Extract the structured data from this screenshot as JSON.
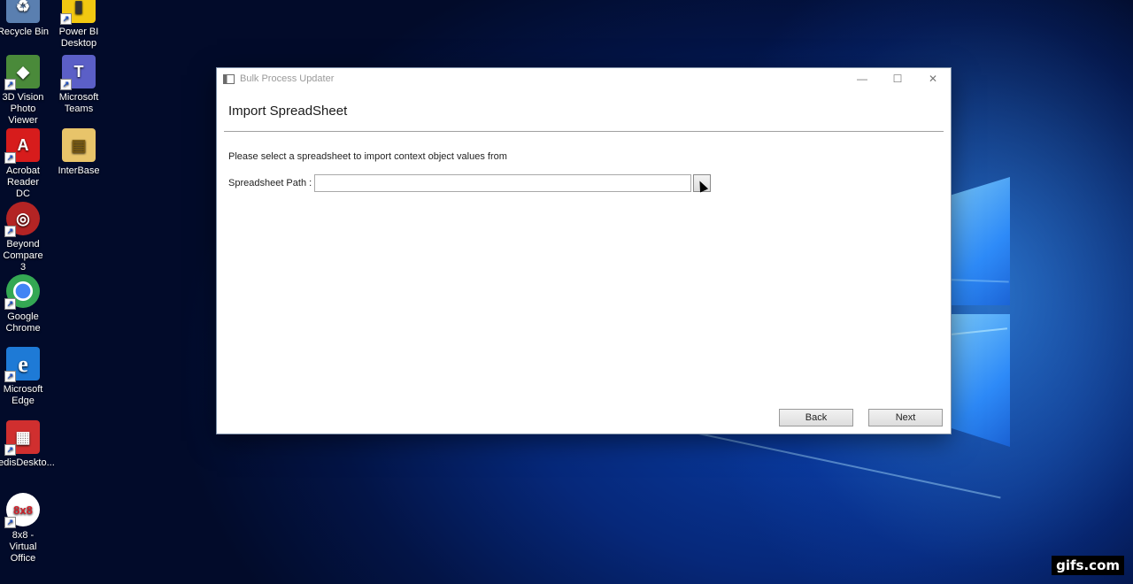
{
  "desktop": {
    "icons": [
      {
        "label": "Recycle Bin",
        "glyph": "♻",
        "color": "#5a7fb0"
      },
      {
        "label": "Power BI Desktop",
        "glyph": "▮",
        "color": "#f2c811"
      },
      {
        "label": "3D Vision Photo Viewer",
        "glyph": "◆",
        "color": "#4a8a3a"
      },
      {
        "label": "Microsoft Teams",
        "glyph": "T",
        "color": "#5b5fc7"
      },
      {
        "label": "Acrobat Reader DC",
        "glyph": "A",
        "color": "#d71c1c"
      },
      {
        "label": "InterBase",
        "glyph": "▤",
        "color": "#e8c46a"
      },
      {
        "label": "Beyond Compare 3",
        "glyph": "◎",
        "color": "#b32424"
      },
      {
        "label": "Google Chrome",
        "glyph": "◉",
        "color": "#34a853"
      },
      {
        "label": "Microsoft Edge",
        "glyph": "e",
        "color": "#1e7ad6"
      },
      {
        "label": "RedisDeskto...",
        "glyph": "▦",
        "color": "#d02f2f"
      },
      {
        "label": "8x8 - Virtual Office",
        "glyph": "8x8",
        "color": "#ffffff"
      }
    ],
    "shortcut_glyph": "↗",
    "watermark": "gifs.com"
  },
  "window": {
    "title": "Bulk Process Updater",
    "controls": {
      "minimize": "—",
      "maximize": "☐",
      "close": "✕"
    },
    "heading": "Import SpreadSheet",
    "instruction": "Please select a spreadsheet to import context object values from",
    "path_label": "Spreadsheet Path :",
    "path_value": "",
    "browse_label": "",
    "back_label": "Back",
    "next_label": "Next"
  }
}
